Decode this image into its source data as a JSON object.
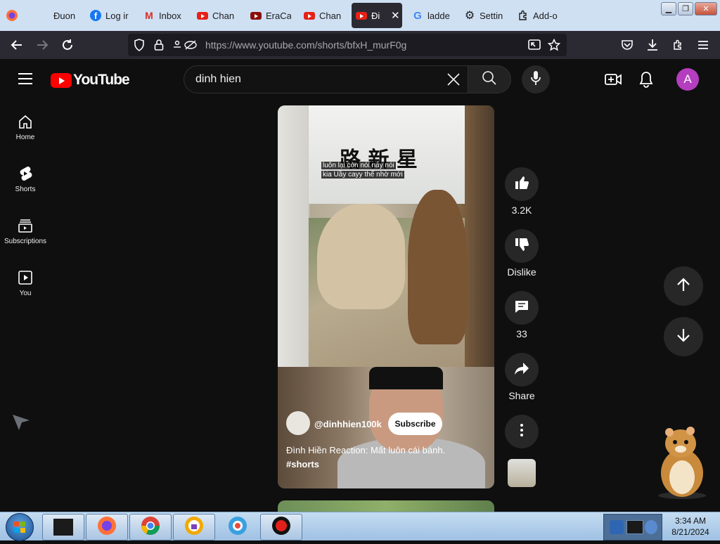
{
  "browser": {
    "tabs": [
      {
        "label": "Đuon",
        "icon": "blank-icon"
      },
      {
        "label": "Log ir",
        "icon": "facebook-icon"
      },
      {
        "label": "Inbox",
        "icon": "gmail-icon"
      },
      {
        "label": "Chan",
        "icon": "youtube-icon"
      },
      {
        "label": "EraCa",
        "icon": "youtube-dark-icon"
      },
      {
        "label": "Chan",
        "icon": "youtube-icon"
      },
      {
        "label": "Đi",
        "icon": "youtube-icon",
        "active": true
      },
      {
        "label": "ladde",
        "icon": "google-icon"
      },
      {
        "label": "Settin",
        "icon": "gear-icon"
      },
      {
        "label": "Add-o",
        "icon": "puzzle-icon"
      }
    ],
    "url": "https://www.youtube.com/shorts/bfxH_murF0g"
  },
  "youtube": {
    "logo_text": "YouTube",
    "search_value": "dinh hien",
    "avatar_letter": "A",
    "guide": [
      {
        "label": "Home",
        "icon": "home-icon"
      },
      {
        "label": "Shorts",
        "icon": "shorts-icon"
      },
      {
        "label": "Subscriptions",
        "icon": "subscriptions-icon"
      },
      {
        "label": "You",
        "icon": "you-icon"
      }
    ]
  },
  "short": {
    "overlay_chinese": "路 新 星",
    "subtitle_line1": "luôn lại còn nói này nói",
    "subtitle_line2": "kia Uầy cayy thế nhờ mới",
    "channel_handle": "@dinhhien100k",
    "subscribe_label": "Subscribe",
    "title": "Đình Hiền Reaction: Mất luôn cái bánh.",
    "hashtag": "#shorts",
    "likes": "3.2K",
    "dislike_label": "Dislike",
    "comments": "33",
    "share_label": "Share"
  },
  "taskbar": {
    "time": "3:34 AM",
    "date": "8/21/2024"
  },
  "colors": {
    "youtube_red": "#ff0000",
    "page_bg": "#0f0f0f",
    "button_bg": "#272727",
    "avatar_bg": "#b43ebf"
  }
}
